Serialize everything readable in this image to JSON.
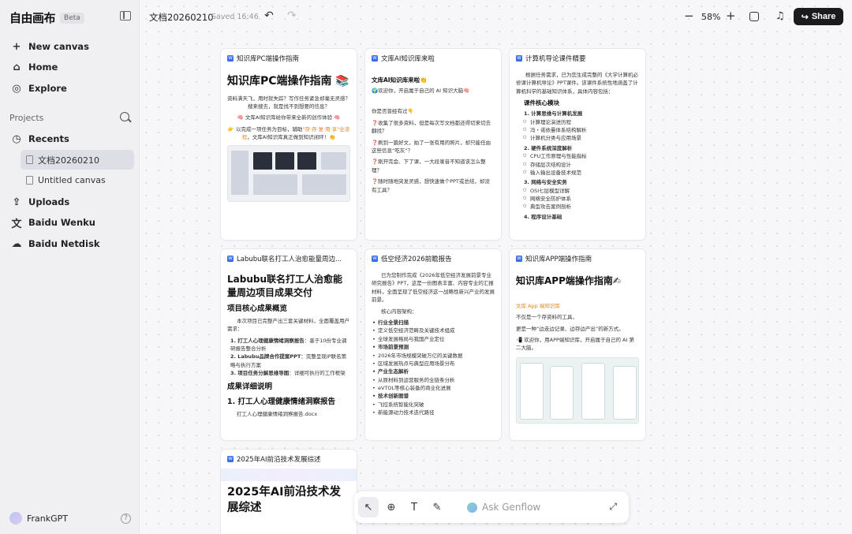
{
  "app": {
    "logo": "自由画布",
    "beta": "Beta"
  },
  "sidebar": {
    "nav": [
      {
        "label": "New canvas",
        "icon": "+"
      },
      {
        "label": "Home",
        "icon": "⌂"
      },
      {
        "label": "Explore",
        "icon": "◎"
      }
    ],
    "projects_label": "Projects",
    "recents": {
      "label": "Recents",
      "icon": "◷"
    },
    "recent_items": [
      "文档20260210",
      "Untitled canvas"
    ],
    "bottom_nav": [
      {
        "label": "Uploads",
        "icon": "⇪"
      },
      {
        "label": "Baidu Wenku",
        "icon": "文"
      },
      {
        "label": "Baidu Netdisk",
        "icon": "☁"
      }
    ],
    "user": {
      "name": "FrankGPT",
      "help": "?"
    }
  },
  "topbar": {
    "title": "文档20260210",
    "saved": "Saved 16:46",
    "undo": "↶",
    "redo": "↷",
    "zoom_minus": "−",
    "zoom": "58%",
    "zoom_plus": "+",
    "bell": "♫",
    "share": "Share",
    "share_icon": "↪"
  },
  "cards": {
    "c1": {
      "title": "知识库PC端操作指南",
      "h1": "知识库PC端操作指南 📚",
      "p1": "资料满天飞，用时就失踪？写作任务紧急却毫无灵感？搜来搜去，就是找不到想要的信息？",
      "p2": "🧠 文库AI知识库给你带来全新的创作体验 🧠",
      "p3a": "👉 以完成一项任务为目标，辅助",
      "p3b": "\"存·存·复·用·享\"全流程",
      "p3c": "，文库AI知识库真正做到知识闭环！👏"
    },
    "c2": {
      "title": "文库AI知识库来啦",
      "h": "文库AI知识库来啦👏",
      "p1": "🌍欢迎你，开启属于自己的 AI 知识大脑🧠",
      "p2": "你是否曾经有过👇",
      "p3": "❓收集了很多资料，但是每次写文档都还得切来切去翻找？",
      "p4": "❓刷到一篇好文，拍了一张有用的照片，却只能任由这些信息“吃灰”？",
      "p5": "❓刚开完会、下了课，一大段录音不知道该怎么整理？",
      "p6": "❓随时随地突发灵感，想快速做个PPT或总结，却没有工具？"
    },
    "c3": {
      "title": "计算机导论课件精要",
      "intro": "根据任务需求，已为您生成完整的《大学计算机必修课计算机导论》PPT课件。该课件系统性地涵盖了计算机科学的基础知识体系，具体内容包括：",
      "module": "课件核心模块",
      "s1": "1. 计算思维与计算机发展",
      "s1a": "计算理论演进历程",
      "s1b": "冯・诺依曼体系结构解析",
      "s1c": "计算机分类与应用场景",
      "s2": "2. 硬件系统深度解析",
      "s2a": "CPU工作原理与性能指标",
      "s2b": "存储层次结构设计",
      "s2c": "输入输出设备技术规范",
      "s3": "3. 网络与安全实务",
      "s3a": "OSI七层模型详解",
      "s3b": "网络安全防护体系",
      "s3c": "典型攻击案例剖析",
      "s4": "4. 程序设计基础"
    },
    "c4": {
      "title": "Labubu联名打工人治愈能量周边...",
      "h1": "Labubu联名打工人治愈能量周边项目成果交付",
      "h2": "项目核心成果概览",
      "p1": "本次项目已完整产出三套关键材料，全面覆盖用户需求：",
      "o1a": "1. 打工人心理健康情绪洞察报告",
      "o1b": "：基于10份专业调研报告整合分析",
      "o2a": "2. Labubu品牌合作提案PPT",
      "o2b": "：完整呈现IP联名策略与执行方案",
      "o3a": "3. 项目任务分解思维导图",
      "o3b": "：详细可执行的工作框架",
      "h2b": "成果详细说明",
      "h2c": "1. 打工人心理健康情绪洞察报告",
      "file": "打工人心理健康情绪洞察报告.docx"
    },
    "c5": {
      "title": "低空经济2026前瞻报告",
      "intro": "已为您制作完成《2026年低空经济发展前景专业研究报告》PPT，这是一份图表丰富、内容专业的汇报材料，全面呈现了低空经济这一战略性新兴产业的发展前景。",
      "arch": "核心内容架构：",
      "a": "行业全景扫描",
      "a1": "定义低空经济范畴及关键技术组成",
      "a2": "全球发展格局与我国产业定位",
      "b": "市场前景预测",
      "b1": "2026年市场规模突破万亿的关键数据",
      "b2": "区域发展热点与典型应用场景分布",
      "c": "产业生态解析",
      "c1": "从原材料到运营服务的全链条分析",
      "c2": "eVTOL等核心装备的商业化进展",
      "d": "技术创新图谱",
      "d1": "飞控系统智能化突破",
      "d2": "新能源动力技术迭代路径"
    },
    "c6": {
      "title": "知识库APP端操作指南",
      "h1": "知识库APP端操作指南✍",
      "tag": "文库 App 端知识库",
      "p1": "不仅是一个存资料的工具，",
      "p2": "更是一种“边走边记录、边存边产出”的新方式。",
      "p3": "📲 欢迎你，用APP端知识库，开启属于自己的 AI 第二大脑。"
    },
    "c7": {
      "title": "2025年AI前沿技术发展综述",
      "h1": "2025年AI前沿技术发展综述"
    }
  },
  "toolbar": {
    "select": "↖",
    "add": "⊕",
    "text": "T",
    "draw": "✎",
    "ask": "Ask Genflow",
    "expand": "⤢"
  }
}
